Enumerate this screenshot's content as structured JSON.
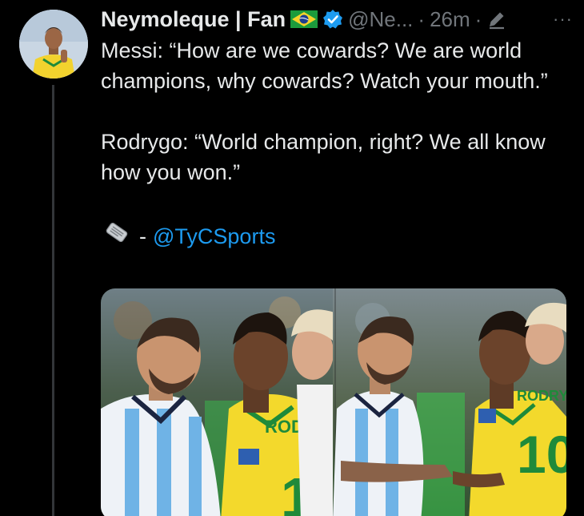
{
  "tweet": {
    "display_name": "Neymoleque | Fan",
    "handle": "@Ne...",
    "separator": "·",
    "time": "26m",
    "more_label": "···",
    "paragraphs": [
      "Messi: “How are we cowards? We are world champions, why cowards? Watch your mouth.”",
      "Rodrygo: “World champion, right? We all know how you won.”"
    ],
    "source_prefix": "- ",
    "source_link": "@TyCSports",
    "icons": [
      "brazil-flag-icon",
      "verified-badge-icon",
      "edit-pencil-icon",
      "newspaper-icon",
      "more-icon"
    ]
  },
  "colors": {
    "background": "#000000",
    "text": "#e7e9ea",
    "muted": "#71767b",
    "link": "#1d9bf0",
    "verified": "#1d9bf0"
  }
}
